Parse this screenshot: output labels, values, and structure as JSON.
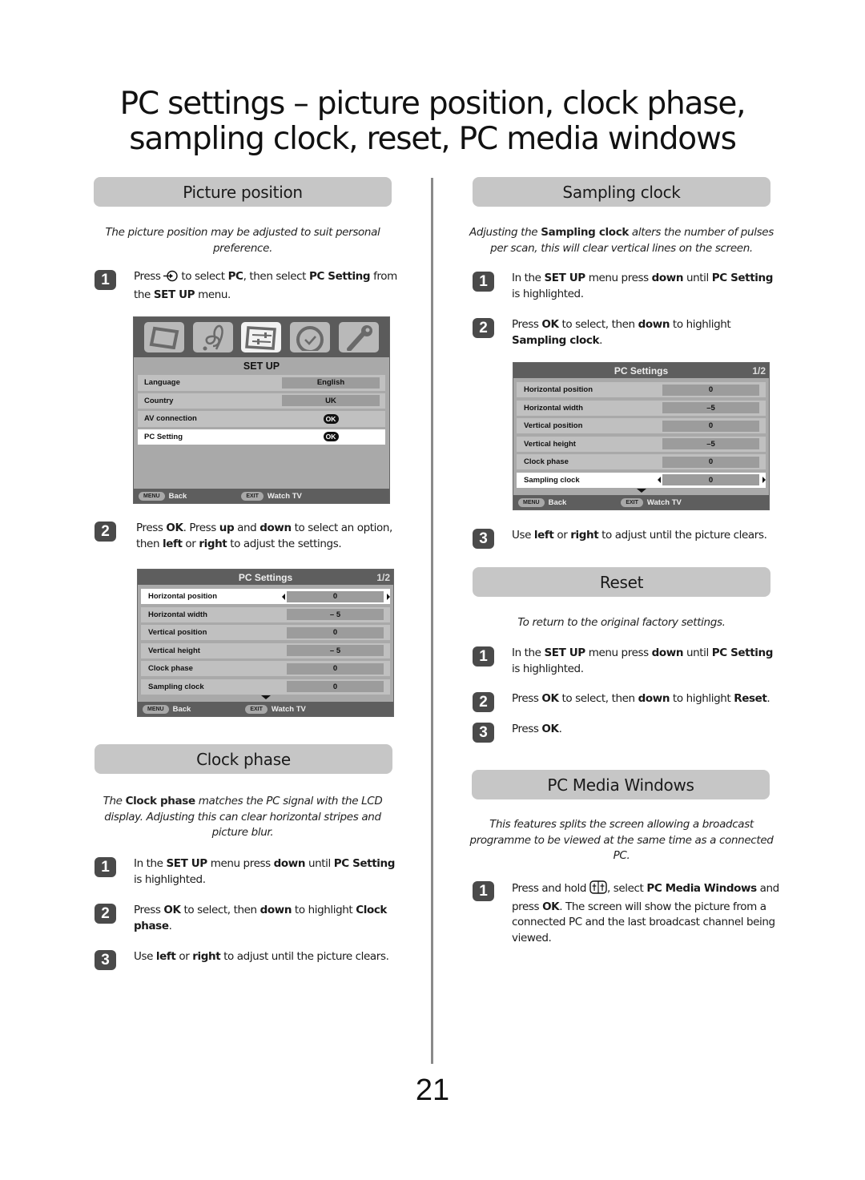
{
  "page": {
    "title_line1": "PC settings – picture position, clock phase,",
    "title_line2": "sampling clock, reset, PC media windows",
    "page_number": "21"
  },
  "picture_position": {
    "header": "Picture position",
    "intro": "The picture position may be adjusted to suit personal preference.",
    "steps": [
      {
        "num": "1",
        "html": "Press <ICON:input-select> to select <b>PC</b>, then select <b>PC Setting</b> from the <b>SET UP</b> menu."
      },
      {
        "num": "2",
        "html": "Press <b>OK</b>. Press <b>up</b> and <b>down</b> to select an option, then <b>left</b> or <b>right</b> to adjust the settings."
      }
    ],
    "setup_menu": {
      "icons": [
        "picture-icon",
        "sound-icon",
        "setup-icon",
        "timer-icon",
        "settings-wrench-icon"
      ],
      "active_icon": 2,
      "title": "SET UP",
      "rows": [
        {
          "label": "Language",
          "value": "English",
          "type": "value"
        },
        {
          "label": "Country",
          "value": "UK",
          "type": "value"
        },
        {
          "label": "AV connection",
          "value": "OK",
          "type": "ok"
        },
        {
          "label": "PC Setting",
          "value": "OK",
          "type": "ok",
          "selected": true
        }
      ],
      "footer": {
        "menu_key": "MENU",
        "back": "Back",
        "exit_key": "EXIT",
        "watch": "Watch TV"
      }
    },
    "pc_menu": {
      "title": "PC Settings",
      "page": "1/2",
      "selected_index": 0,
      "rows": [
        {
          "label": "Horizontal position",
          "value": "0"
        },
        {
          "label": "Horizontal width",
          "value": "– 5"
        },
        {
          "label": "Vertical position",
          "value": "0"
        },
        {
          "label": "Vertical height",
          "value": "– 5"
        },
        {
          "label": "Clock phase",
          "value": "0"
        },
        {
          "label": "Sampling clock",
          "value": "0"
        }
      ],
      "footer": {
        "menu_key": "MENU",
        "back": "Back",
        "exit_key": "EXIT",
        "watch": "Watch TV"
      }
    }
  },
  "clock_phase": {
    "header": "Clock phase",
    "intro": "The <b>Clock phase</b> matches the PC signal with the LCD display. Adjusting this can clear horizontal stripes and picture blur.",
    "steps": [
      {
        "num": "1",
        "html": "In the <b>SET UP</b> menu press <b>down</b> until <b>PC Setting</b> is highlighted."
      },
      {
        "num": "2",
        "html": "Press <b>OK</b> to select, then <b>down</b> to highlight <b>Clock phase</b>."
      },
      {
        "num": "3",
        "html": "Use <b>left</b> or <b>right</b> to adjust until the picture clears."
      }
    ]
  },
  "sampling_clock": {
    "header": "Sampling clock",
    "intro": "Adjusting the <b>Sampling clock</b> alters the number of pulses per scan, this will clear vertical lines on the screen.",
    "steps": [
      {
        "num": "1",
        "html": "In the <b>SET UP</b> menu press <b>down</b> until <b>PC Setting</b> is highlighted."
      },
      {
        "num": "2",
        "html": "Press <b>OK</b> to select, then <b>down</b> to highlight <b>Sampling clock</b>."
      },
      {
        "num": "3",
        "html": "Use <b>left</b> or <b>right</b> to adjust until the picture clears."
      }
    ],
    "pc_menu": {
      "title": "PC Settings",
      "page": "1/2",
      "selected_index": 5,
      "rows": [
        {
          "label": "Horizontal position",
          "value": "0"
        },
        {
          "label": "Horizontal width",
          "value": "–5"
        },
        {
          "label": "Vertical position",
          "value": "0"
        },
        {
          "label": "Vertical height",
          "value": "–5"
        },
        {
          "label": "Clock phase",
          "value": "0"
        },
        {
          "label": "Sampling clock",
          "value": "0"
        }
      ],
      "footer": {
        "menu_key": "MENU",
        "back": "Back",
        "exit_key": "EXIT",
        "watch": "Watch TV"
      }
    }
  },
  "reset": {
    "header": "Reset",
    "intro": "To return to the original factory settings.",
    "steps": [
      {
        "num": "1",
        "html": "In the <b>SET UP</b> menu press <b>down</b> until <b>PC Setting</b> is highlighted."
      },
      {
        "num": "2",
        "html": "Press <b>OK</b> to select, then <b>down</b> to highlight <b>Reset</b>."
      },
      {
        "num": "3",
        "html": "Press <b>OK</b>."
      }
    ]
  },
  "pc_media_windows": {
    "header": "PC Media Windows",
    "intro": "This features splits the screen allowing a broadcast programme to be viewed at the same time as a connected PC.",
    "steps": [
      {
        "num": "1",
        "html": "Press and hold <ICON:split-screen>, select <b>PC Media Windows</b> and press <b>OK</b>. The screen will show the picture from a connected PC and the last broadcast channel being viewed."
      }
    ]
  }
}
